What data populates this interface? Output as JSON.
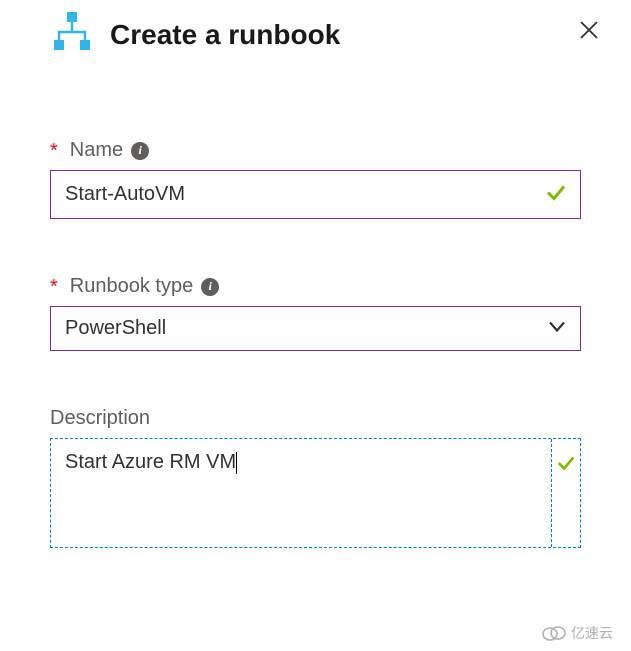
{
  "header": {
    "title": "Create a runbook"
  },
  "fields": {
    "name": {
      "label": "Name",
      "required": true,
      "value": "Start-AutoVM",
      "valid": true
    },
    "runbookType": {
      "label": "Runbook type",
      "required": true,
      "value": "PowerShell"
    },
    "description": {
      "label": "Description",
      "required": false,
      "value": "Start Azure RM VM",
      "valid": true
    }
  },
  "colors": {
    "accent": "#7b2e8e",
    "focus": "#0078d4",
    "success": "#7fba00",
    "required": "#e00b1c",
    "brandIcon": "#32b4e6"
  },
  "watermark": "亿速云"
}
